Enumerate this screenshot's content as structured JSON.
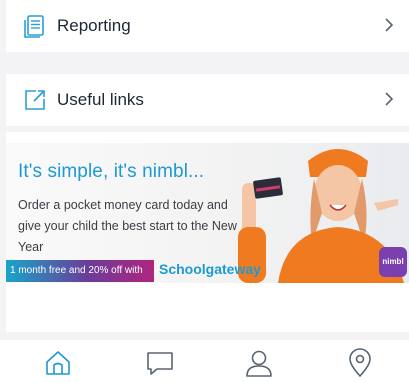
{
  "menu": {
    "reporting": {
      "label": "Reporting",
      "icon": "document-icon"
    },
    "useful_links": {
      "label": "Useful links",
      "icon": "external-link-icon"
    }
  },
  "promo": {
    "headline": "It's simple, it's nimbl...",
    "body": "Order a pocket money card today and give your child the best start to the New Year",
    "offer": "1 month free and 20% off with",
    "brand": "Schoolgateway",
    "badge": "nimbl"
  },
  "tabbar": {
    "items": [
      {
        "icon": "home-icon",
        "active": true
      },
      {
        "icon": "chat-icon",
        "active": false
      },
      {
        "icon": "profile-icon",
        "active": false
      },
      {
        "icon": "location-pin-icon",
        "active": false
      }
    ]
  },
  "colors": {
    "accent": "#1d9ad0",
    "text": "#1d2733",
    "muted": "#9aa2ab",
    "background": "#f3f3f5"
  }
}
